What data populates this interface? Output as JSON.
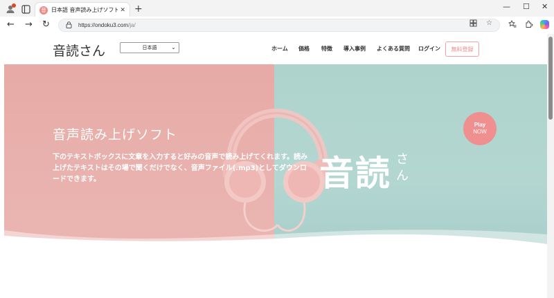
{
  "browser": {
    "tab_title": "日本語 音声読み上げソフト|音読さん",
    "url_host": "https://ondoku3.com",
    "url_path": "/ja/",
    "icons": [
      "profile-icon",
      "tab-actions-icon",
      "close-icon",
      "new-tab-icon",
      "back-icon",
      "forward-icon",
      "reload-icon",
      "lock-icon",
      "app-icon",
      "favorite-icon",
      "favorites-icon",
      "extensions-icon",
      "copilot-icon",
      "minimize-icon",
      "maximize-icon"
    ]
  },
  "site": {
    "logo": "音読さん",
    "language_select": "日本語",
    "menu": [
      "ホーム",
      "価格",
      "特徴",
      "導入事例",
      "よくある質問",
      "ログイン"
    ],
    "signup": "無料登録"
  },
  "hero": {
    "title": "音声読み上げソフト",
    "text": "下のテキストボックスに文章を入力すると好みの音声で読み上げてくれます。読み上げたテキストはその場で聞くだけでなく、音声ファイル(.mp3)としてダウンロードできます。",
    "brand_big": "音読",
    "brand_small": "さん",
    "play_line1": "Play",
    "play_line2": "NOW"
  },
  "colors": {
    "pink": "#e9b2ae",
    "mint": "#b3d6d0",
    "accent": "#f08a8a"
  }
}
